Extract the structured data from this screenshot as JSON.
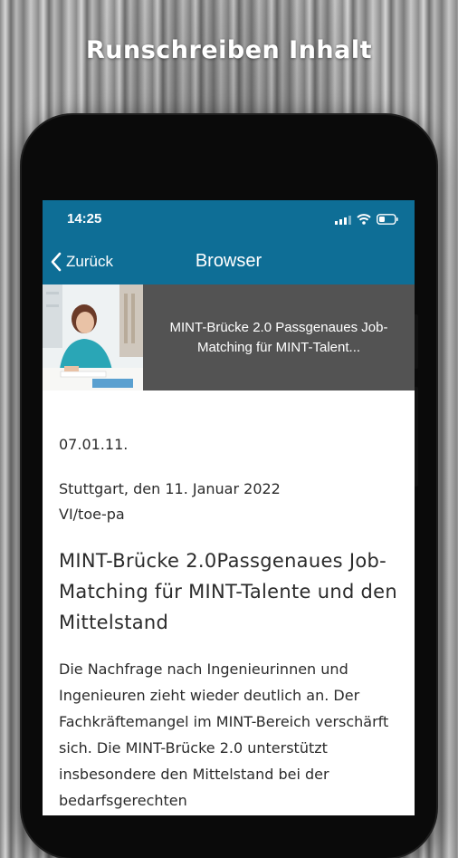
{
  "page": {
    "headline": "Runschreiben Inhalt"
  },
  "status_bar": {
    "time": "14:25",
    "icons": [
      "signal-icon",
      "wifi-icon",
      "battery-icon"
    ]
  },
  "nav": {
    "back_label": "Zurück",
    "title": "Browser"
  },
  "card": {
    "title": "MINT-Brücke 2.0 Passgenaues Job-Matching für MINT-Talent..."
  },
  "article": {
    "reference": "07.01.11.",
    "place_date": "Stuttgart, den 11. Januar 2022",
    "code": "VI/toe-pa",
    "heading": "MINT-Brücke 2.0Passgenaues Job-Matching für MINT-Talente und den Mittelstand",
    "body": "Die Nachfrage nach Ingenieurinnen und Ingenieuren zieht wieder deutlich an. Der Fachkräftemangel im MINT-Bereich verschärft sich. Die MINT-Brücke 2.0 unterstützt insbesondere den Mittelstand bei der bedarfsgerechten"
  },
  "colors": {
    "nav_blue": "#0e6e96",
    "card_gray": "#535353"
  }
}
